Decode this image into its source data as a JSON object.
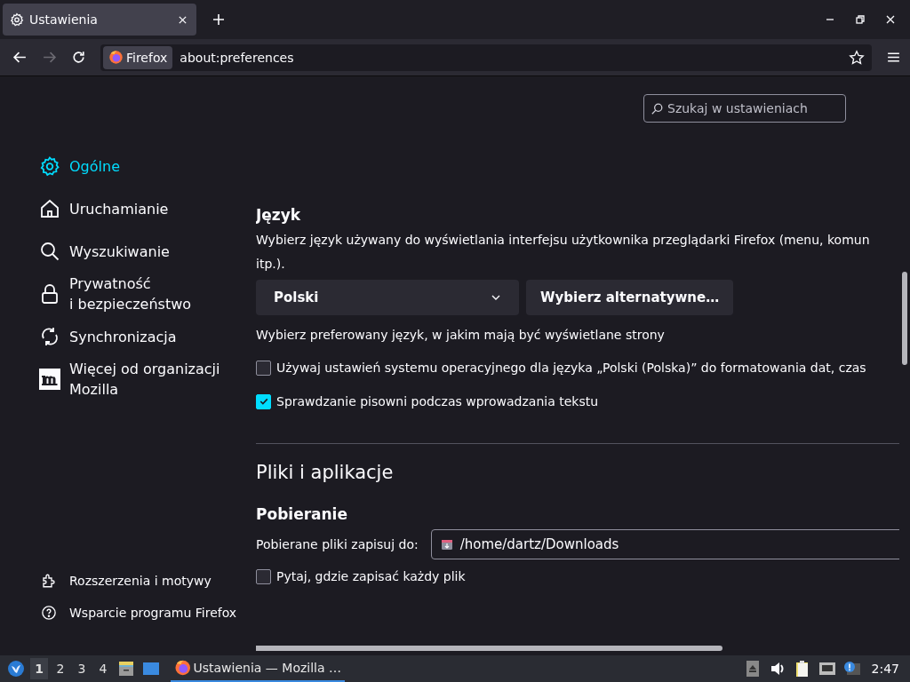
{
  "tabs": [
    {
      "title": "Ustawienia",
      "selected": true
    }
  ],
  "toolbar": {
    "forward_disabled": true,
    "identity_label": "Firefox",
    "url": "about:preferences"
  },
  "search": {
    "placeholder": "Szukaj w ustawieniach"
  },
  "sidebar": {
    "items": [
      {
        "label": "Ogólne",
        "kind": "gear",
        "selected": true
      },
      {
        "label": "Uruchamianie",
        "kind": "home",
        "selected": false
      },
      {
        "label": "Wyszukiwanie",
        "kind": "search",
        "selected": false
      },
      {
        "label": "Prywatność i bezpieczeństwo",
        "kind": "lock",
        "selected": false
      },
      {
        "label": "Synchronizacja",
        "kind": "sync",
        "selected": false
      },
      {
        "label": "Więcej od organizacji Mozilla",
        "kind": "mozilla",
        "selected": false
      }
    ],
    "footer": [
      {
        "label": "Rozszerzenia i motywy",
        "kind": "puzzle"
      },
      {
        "label": "Wsparcie programu Firefox",
        "kind": "help"
      }
    ]
  },
  "language": {
    "heading": "Język",
    "description_lines": [
      "Wybierz język używany do wyświetlania interfejsu użytkownika przeglądarki Firefox (menu, komun",
      "itp.)."
    ],
    "dropdown": "Polski",
    "alt_button": "Wybierz alternatywne…",
    "pref_text": "Wybierz preferowany język, w jakim mają być wyświetlane strony",
    "options": [
      {
        "label": "Używaj ustawień systemu operacyjnego dla języka „Polski (Polska)” do formatowania dat, czas",
        "checked": false
      },
      {
        "label": "Sprawdzanie pisowni podczas wprowadzania tekstu",
        "checked": true
      }
    ]
  },
  "files": {
    "heading": "Pliki i aplikacje",
    "subheading": "Pobieranie",
    "save_label": "Pobierane pliki zapisuj do:",
    "save_path": "/home/dartz/Downloads",
    "options": [
      {
        "label": "Pytaj, gdzie zapisać każdy plik",
        "checked": false
      }
    ]
  },
  "taskbar": {
    "workspaces": [
      {
        "label": "1",
        "selected": true
      },
      {
        "label": "2",
        "selected": false
      },
      {
        "label": "3",
        "selected": false
      },
      {
        "label": "4",
        "selected": false
      }
    ],
    "task": "Ustawienia — Mozilla …",
    "clock": "2:47"
  }
}
